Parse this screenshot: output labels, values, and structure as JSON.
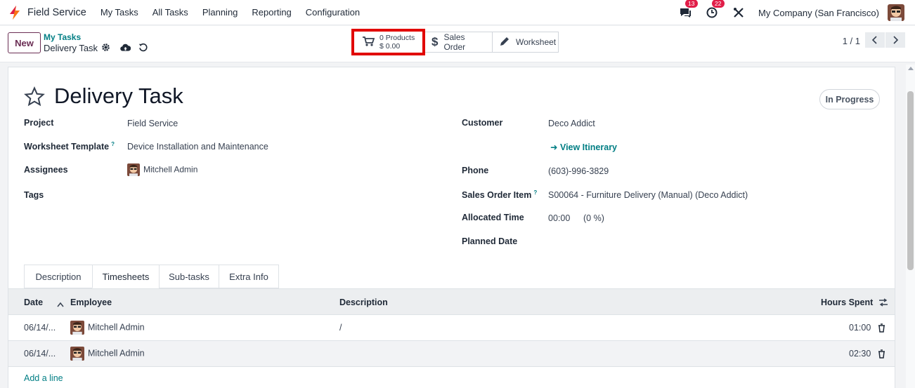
{
  "navbar": {
    "app_name": "Field Service",
    "menu": [
      "My Tasks",
      "All Tasks",
      "Planning",
      "Reporting",
      "Configuration"
    ],
    "chat_badge": "13",
    "activity_badge": "22",
    "company": "My Company (San Francisco)"
  },
  "control_panel": {
    "new_label": "New",
    "breadcrumb_parent": "My Tasks",
    "breadcrumb_current": "Delivery Task",
    "smart_products_count": "0 Products",
    "smart_products_amount": "$ 0.00",
    "smart_sales_order": "Sales Order",
    "smart_worksheet": "Worksheet",
    "pager": "1 / 1"
  },
  "form": {
    "title": "Delivery Task",
    "status": "In Progress",
    "left_fields": {
      "project_label": "Project",
      "project_value": "Field Service",
      "worksheet_label": "Worksheet Template",
      "worksheet_value": "Device Installation and Maintenance",
      "assignees_label": "Assignees",
      "assignees_value": "Mitchell Admin",
      "tags_label": "Tags"
    },
    "right_fields": {
      "customer_label": "Customer",
      "customer_value": "Deco Addict",
      "itinerary_link": "View Itinerary",
      "phone_label": "Phone",
      "phone_value": "(603)-996-3829",
      "sales_item_label": "Sales Order Item",
      "sales_item_value": "S00064 - Furniture Delivery (Manual) (Deco Addict)",
      "allocated_label": "Allocated Time",
      "allocated_value": "00:00",
      "allocated_pct": "(0 %)",
      "planned_label": "Planned Date"
    },
    "help_mark": "?"
  },
  "tabs": [
    "Description",
    "Timesheets",
    "Sub-tasks",
    "Extra Info"
  ],
  "timesheets": {
    "columns": [
      "Date",
      "Employee",
      "Description",
      "Hours Spent"
    ],
    "rows": [
      {
        "date": "06/14/...",
        "employee": "Mitchell Admin",
        "description": "/",
        "hours": "01:00"
      },
      {
        "date": "06/14/...",
        "employee": "Mitchell Admin",
        "description": "",
        "hours": "02:30"
      }
    ],
    "add_line": "Add a line"
  },
  "colors": {
    "brand": "#6b2e54",
    "teal": "#017e84",
    "highlight": "#e10600",
    "badge": "#e11d48"
  }
}
